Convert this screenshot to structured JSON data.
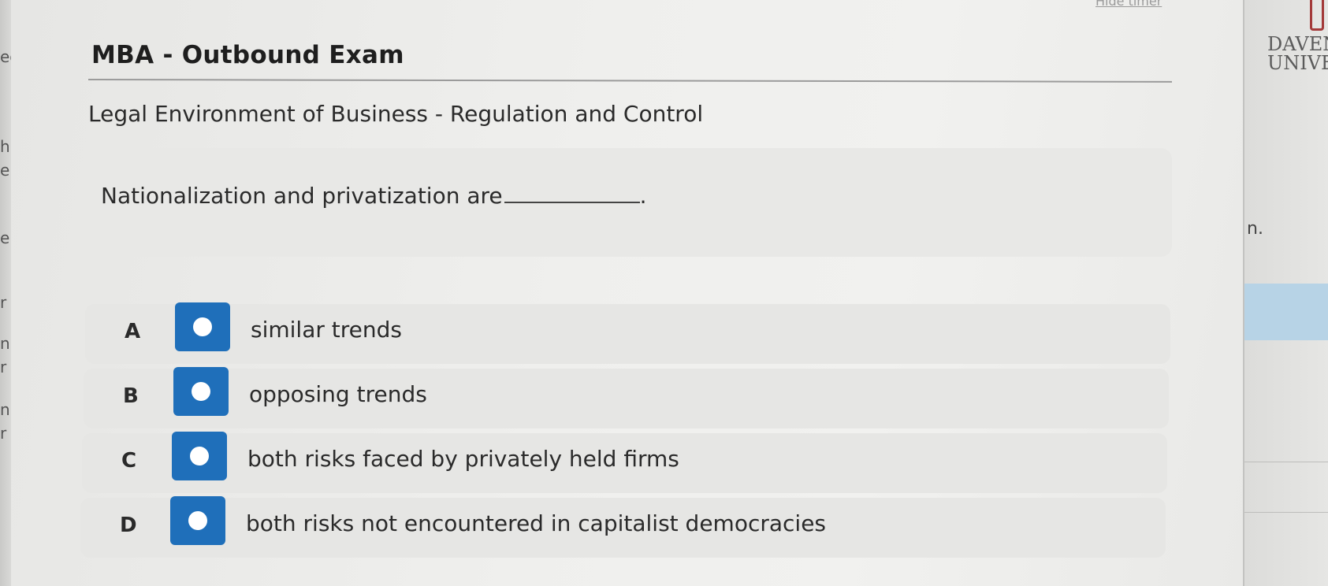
{
  "header": {
    "timer_link": "Hide timer",
    "exam_title": "MBA - Outbound Exam",
    "subtitle": "Legal Environment of Business - Regulation and Control"
  },
  "question": {
    "text": "Nationalization and privatization are",
    "end": "."
  },
  "options": [
    {
      "letter": "A",
      "text": "similar trends"
    },
    {
      "letter": "B",
      "text": "opposing trends"
    },
    {
      "letter": "C",
      "text": "both risks faced by privately held firms"
    },
    {
      "letter": "D",
      "text": "both risks not encountered in capitalist democracies"
    }
  ],
  "left_fragments": [
    "ec",
    "h",
    "er",
    "er",
    "r",
    "n",
    "r",
    "n",
    "r"
  ],
  "right_side": {
    "logo_line1": "DAVEN",
    "logo_line2": "UNIVE",
    "fragment": "n.",
    "logo_color": "#a33a3a",
    "highlight_color": "#b7d3e6"
  },
  "colors": {
    "radio_button": "#1f6fba",
    "text": "#2a2a2a"
  }
}
